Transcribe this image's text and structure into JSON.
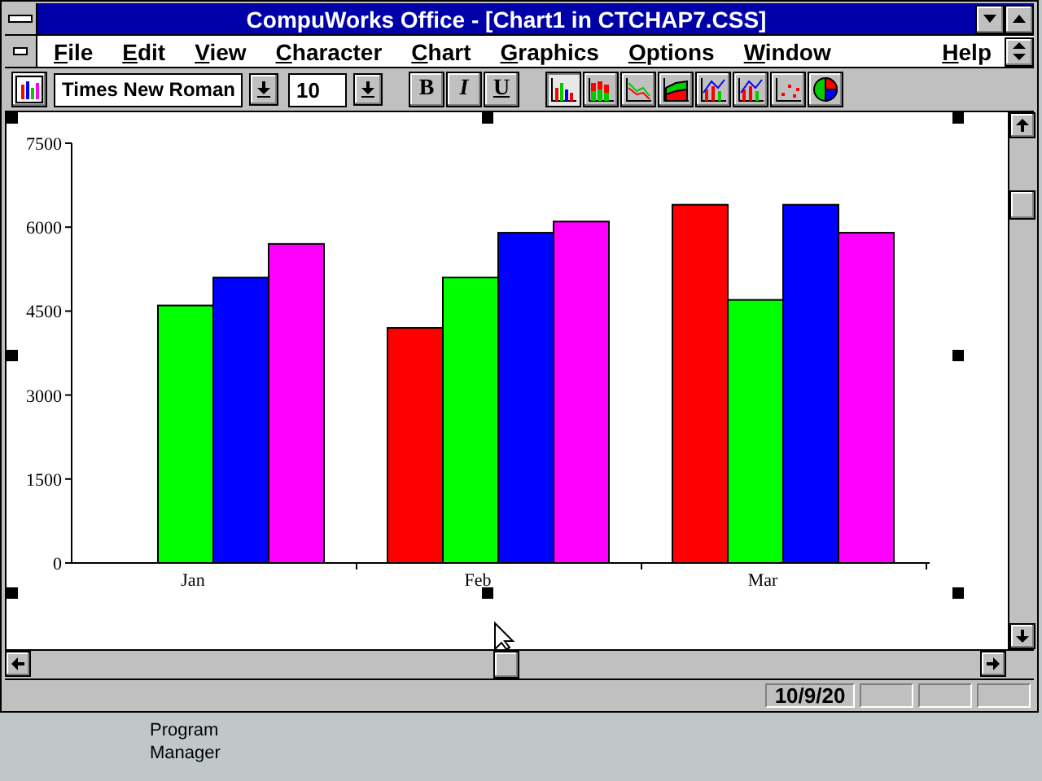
{
  "window": {
    "title": "CompuWorks Office - [Chart1 in CTCHAP7.CSS]"
  },
  "menu": [
    {
      "label": "File"
    },
    {
      "label": "Edit"
    },
    {
      "label": "View"
    },
    {
      "label": "Character"
    },
    {
      "label": "Chart"
    },
    {
      "label": "Graphics"
    },
    {
      "label": "Options"
    },
    {
      "label": "Window"
    },
    {
      "label": "Help"
    }
  ],
  "toolbar": {
    "font": "Times New Roman",
    "size": "10",
    "format_buttons": [
      {
        "kind": "bold",
        "label": "B"
      },
      {
        "kind": "italic",
        "label": "I"
      },
      {
        "kind": "underline",
        "label": "U"
      }
    ],
    "chart_types": [
      {
        "kind": "bar",
        "selected": true
      },
      {
        "kind": "stacked",
        "selected": false
      },
      {
        "kind": "line",
        "selected": false
      },
      {
        "kind": "area",
        "selected": false
      },
      {
        "kind": "barline",
        "selected": false
      },
      {
        "kind": "barline",
        "selected": false
      },
      {
        "kind": "scatter",
        "selected": false
      },
      {
        "kind": "pie",
        "selected": false
      }
    ]
  },
  "chart": {
    "chart_data": {
      "type": "bar",
      "categories": [
        "Jan",
        "Feb",
        "Mar"
      ],
      "ylim": [
        0,
        7500
      ],
      "yticks": [
        0,
        1500,
        3000,
        4500,
        6000,
        7500
      ],
      "series": [
        {
          "color": "#ff0000",
          "values": [
            null,
            4200,
            6400
          ]
        },
        {
          "color": "#00ff00",
          "values": [
            4600,
            5100,
            4700
          ]
        },
        {
          "color": "#0000ff",
          "values": [
            5100,
            5900,
            6400
          ]
        },
        {
          "color": "#ff00ff",
          "values": [
            5700,
            6100,
            5900
          ]
        }
      ]
    }
  },
  "status_bar": {
    "date": "10/9/20"
  },
  "desktop": {
    "icon_label": "Program Manager"
  }
}
